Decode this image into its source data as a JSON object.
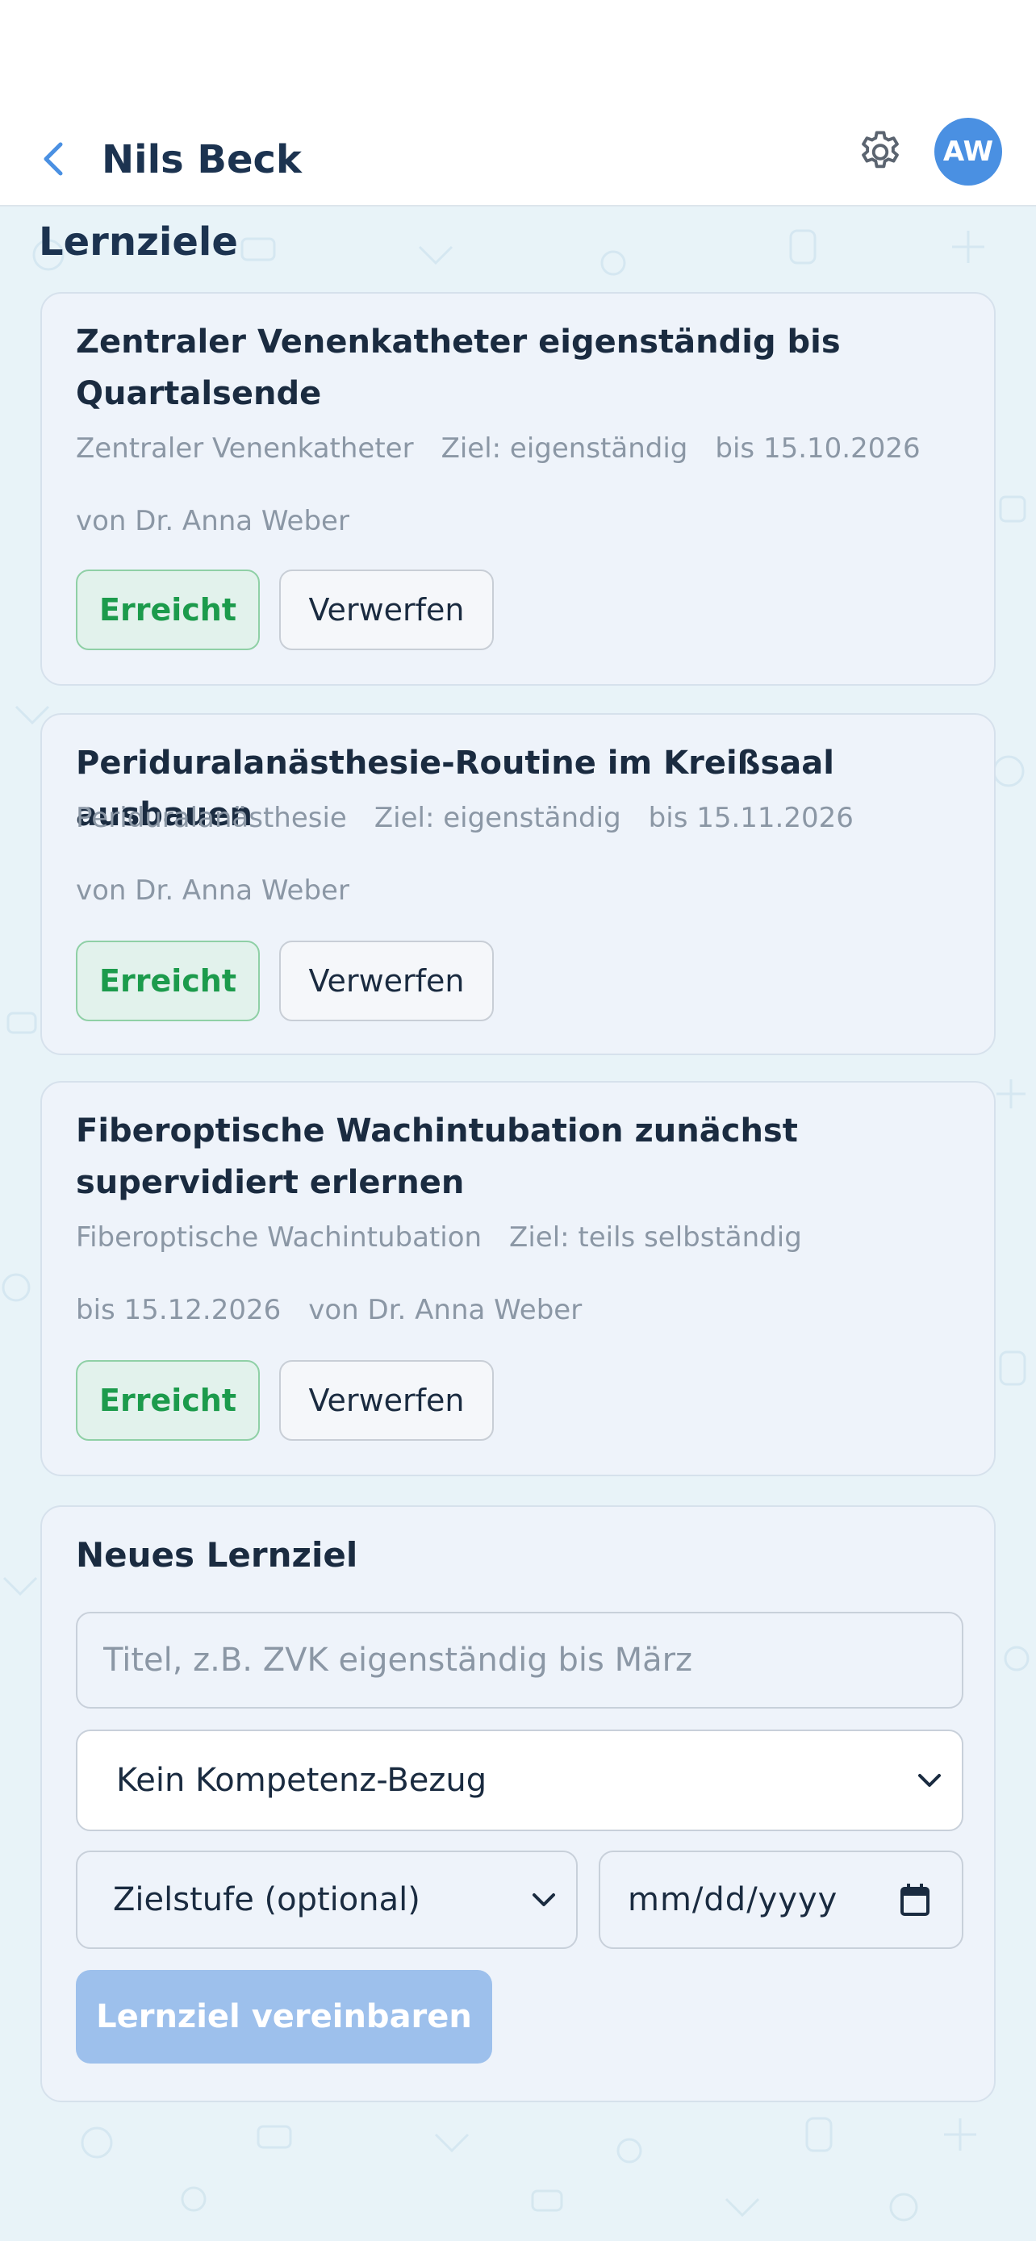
{
  "header": {
    "title": "Nils Beck",
    "avatar_initials": "AW"
  },
  "section_title": "Lernziele",
  "goals": [
    {
      "title": "Zentraler Venenkatheter eigenständig bis Quartalsende",
      "competency": "Zentraler Venenkatheter",
      "target": "Ziel: eigenständig",
      "due": "bis 15.10.2026",
      "author": "von Dr. Anna Weber",
      "reached_label": "Erreicht",
      "discard_label": "Verwerfen"
    },
    {
      "title": "Periduralanästhesie-Routine im Kreißsaal ausbauen",
      "competency": "Periduralanästhesie",
      "target": "Ziel: eigenständig",
      "due": "bis 15.11.2026",
      "author": "von Dr. Anna Weber",
      "reached_label": "Erreicht",
      "discard_label": "Verwerfen"
    },
    {
      "title": "Fiberoptische Wachintubation zunächst supervidiert erlernen",
      "competency": "Fiberoptische Wachintubation",
      "target": "Ziel: teils selbständig",
      "due": "bis 15.12.2026",
      "author": "von Dr. Anna Weber",
      "reached_label": "Erreicht",
      "discard_label": "Verwerfen"
    }
  ],
  "new_goal": {
    "heading": "Neues Lernziel",
    "title_placeholder": "Titel, z.B. ZVK eigenständig bis März",
    "title_value": "",
    "competency_select": "Kein Kompetenz-Bezug",
    "level_select": "Zielstufe (optional)",
    "date_placeholder": "mm/dd/yyyy",
    "submit_label": "Lernziel vereinbaren"
  },
  "colors": {
    "accent": "#4a90e2",
    "success": "#1c9b4c",
    "background": "#e8f3f8",
    "card": "#eef3fa"
  }
}
